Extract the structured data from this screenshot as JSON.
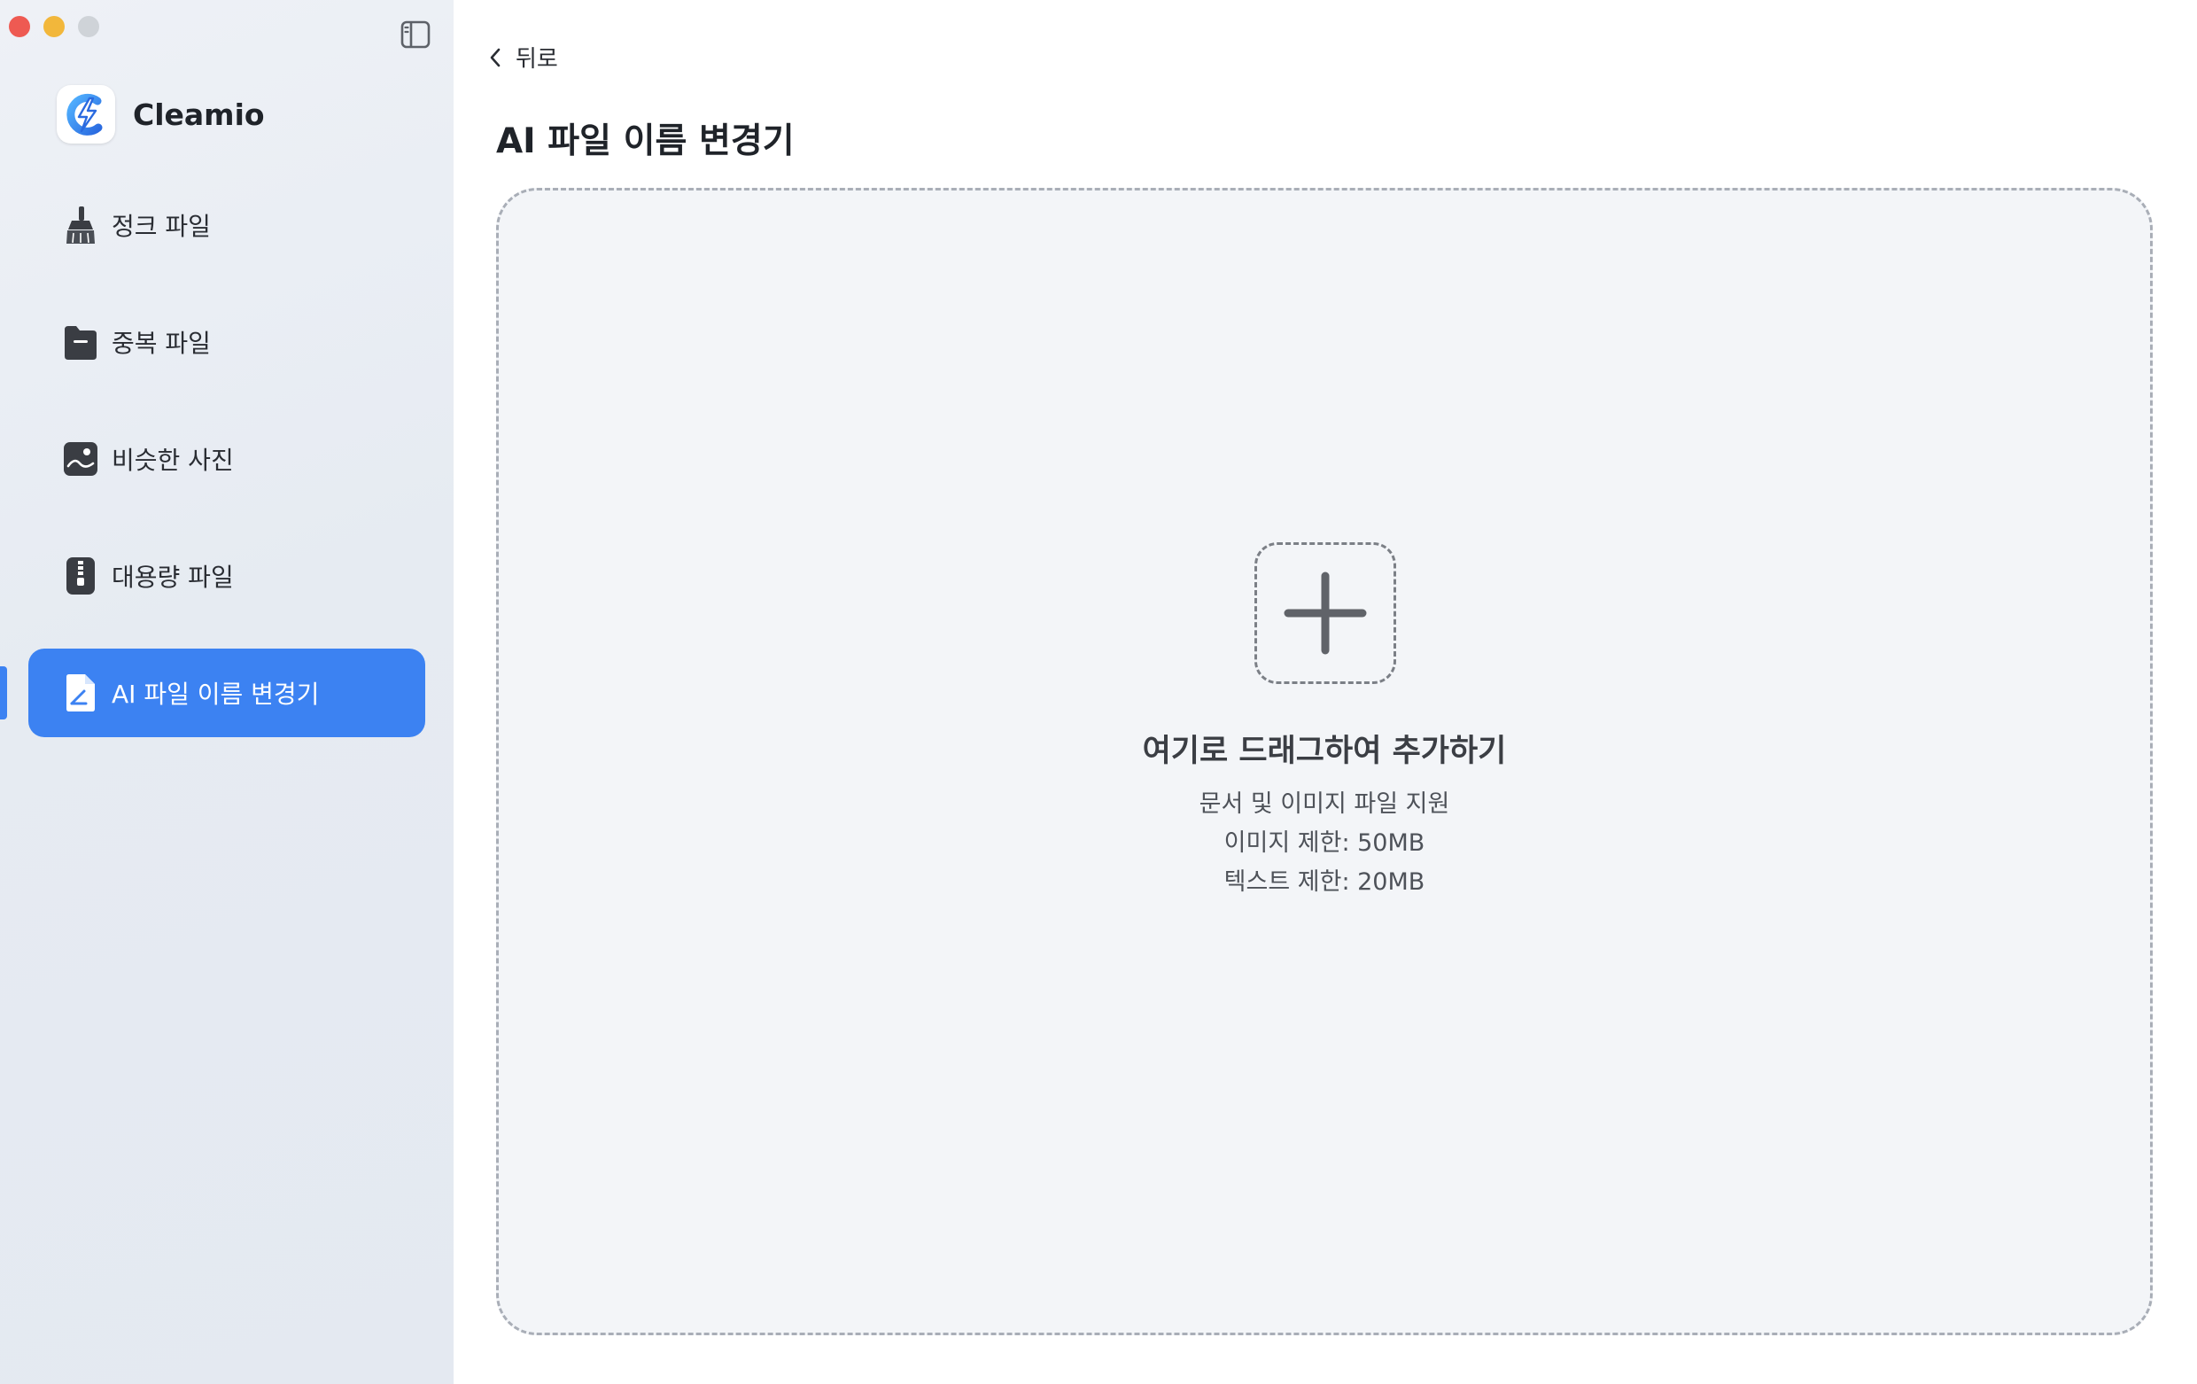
{
  "app": {
    "name": "Cleamio",
    "logo_icon": "lightning-c-logo-icon"
  },
  "window_controls": {
    "close_color": "#ee5a52",
    "minimize_color": "#f2b73b",
    "zoom_color": "#cfd3d8"
  },
  "sidebar": {
    "toggle_icon": "sidebar-toggle-icon",
    "items": [
      {
        "label": "정크 파일",
        "icon": "broom-icon",
        "active": false
      },
      {
        "label": "중복 파일",
        "icon": "folder-icon",
        "active": false
      },
      {
        "label": "비슷한 사진",
        "icon": "photo-icon",
        "active": false
      },
      {
        "label": "대용량 파일",
        "icon": "zip-archive-icon",
        "active": false
      },
      {
        "label": "AI 파일 이름 변경기",
        "icon": "document-rename-icon",
        "active": true
      }
    ]
  },
  "header": {
    "back_label": "뒤로",
    "title": "AI 파일 이름 변경기"
  },
  "dropzone": {
    "add_icon": "plus-icon",
    "title": "여기로 드래그하여 추가하기",
    "supported": "문서 및 이미지 파일 지원",
    "image_limit": "이미지 제한: 50MB",
    "text_limit": "텍스트 제한: 20MB"
  },
  "colors": {
    "accent": "#3c82f2",
    "sidebar_bg": "#e6ebf2",
    "dropzone_bg": "#f3f5f8"
  }
}
